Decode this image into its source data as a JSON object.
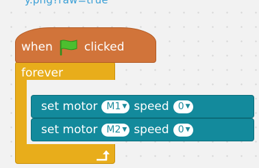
{
  "top_strip_text": "y.png?raw=true",
  "hat_block": {
    "when_label": "when",
    "clicked_label": "clicked",
    "flag_icon": "green-flag-icon",
    "color": "#d1743a"
  },
  "forever_block": {
    "label": "forever",
    "color": "#e8ad1b",
    "loop_icon": "loop-arrow-icon"
  },
  "motor_blocks": [
    {
      "set_label": "set motor",
      "motor_value": "M1",
      "speed_label": "speed",
      "speed_value": "0"
    },
    {
      "set_label": "set motor",
      "motor_value": "M2",
      "speed_label": "speed",
      "speed_value": "0"
    }
  ],
  "colors": {
    "motor_block": "#138a9c",
    "workspace": "#f2f2f2",
    "flag": "#4cbf2f"
  }
}
